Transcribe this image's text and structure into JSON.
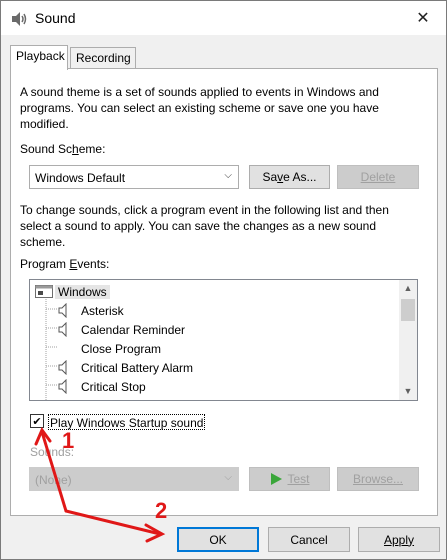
{
  "window": {
    "title": "Sound",
    "close_glyph": "✕"
  },
  "tabs": [
    {
      "label": "Playback"
    },
    {
      "label": "Recording"
    }
  ],
  "panel": {
    "intro_text": "A sound theme is a set of sounds applied to events in Windows and programs.  You can select an existing scheme or save one you have modified.",
    "scheme_label_pre": "Sound Sc",
    "scheme_label_u": "h",
    "scheme_label_post": "eme:",
    "scheme_value": "Windows Default",
    "save_as_pre": "Sa",
    "save_as_u": "v",
    "save_as_post": "e As...",
    "delete_label": "Delete",
    "change_text": "To change sounds, click a program event in the following list and then select a sound to apply.  You can save the changes as a new sound scheme.",
    "events_label_pre": "Program ",
    "events_label_u": "E",
    "events_label_post": "vents:",
    "events": [
      {
        "label": "Windows",
        "icon": "windows-group-icon",
        "level": 0
      },
      {
        "label": "Asterisk",
        "icon": "speaker-icon",
        "level": 1
      },
      {
        "label": "Calendar Reminder",
        "icon": "speaker-icon",
        "level": 1
      },
      {
        "label": "Close Program",
        "icon": "none",
        "level": 1
      },
      {
        "label": "Critical Battery Alarm",
        "icon": "speaker-icon",
        "level": 1
      },
      {
        "label": "Critical Stop",
        "icon": "speaker-icon",
        "level": 1
      }
    ],
    "startup_checkbox_label": "Play Windows Startup sound",
    "startup_checked": true,
    "sounds_label": "Sounds:",
    "sounds_value": "(None)",
    "test_label": "Test",
    "browse_label": "Browse..."
  },
  "footer": {
    "ok_label": "OK",
    "cancel_label": "Cancel",
    "apply_label": "Apply"
  },
  "annotations": {
    "marker_1": "1",
    "marker_2": "2",
    "arrow_color": "#e01818"
  },
  "colors": {
    "focus_blue": "#0078d7",
    "disabled_gray": "#a0a0a0",
    "play_green": "#3aa63a"
  }
}
